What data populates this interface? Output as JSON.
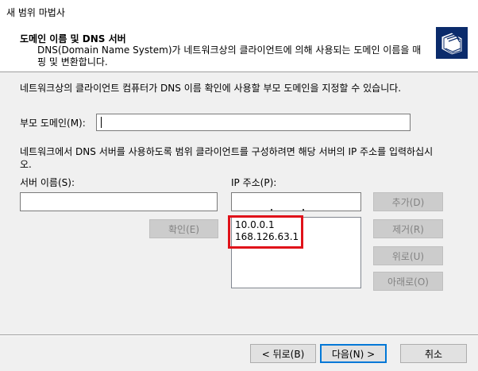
{
  "window": {
    "title": "새 범위 마법사"
  },
  "header": {
    "title": "도메인 이름 및 DNS 서버",
    "description": "DNS(Domain Name System)가 네트워크상의 클라이언트에 의해 사용되는 도메인 이름을 매핑 및 변환합니다.",
    "icon": "folder-stack-icon"
  },
  "content": {
    "intro": "네트워크상의 클라이언트 컴퓨터가 DNS 이름 확인에 사용할 부모 도메인을 지정할 수 있습니다.",
    "parent_domain_label": "부모 도메인(M):",
    "parent_domain_value": "",
    "dns_instruction": "네트워크에서 DNS 서버를 사용하도록 범위 클라이언트를 구성하려면 해당 서버의 IP 주소를 입력하십시오.",
    "server_name_label": "서버 이름(S):",
    "server_name_value": "",
    "ip_label": "IP 주소(P):",
    "ip_value": ". . .",
    "resolve_button": "확인(E)",
    "ip_list": [
      "10.0.0.1",
      "168.126.63.1"
    ],
    "add_button": "추가(D)",
    "remove_button": "제거(R)",
    "up_button": "위로(U)",
    "down_button": "아래로(O)"
  },
  "footer": {
    "back_button": "< 뒤로(B)",
    "next_button": "다음(N) >",
    "cancel_button": "취소"
  },
  "colors": {
    "highlight": "#e0121a",
    "accent": "#0078d7"
  }
}
